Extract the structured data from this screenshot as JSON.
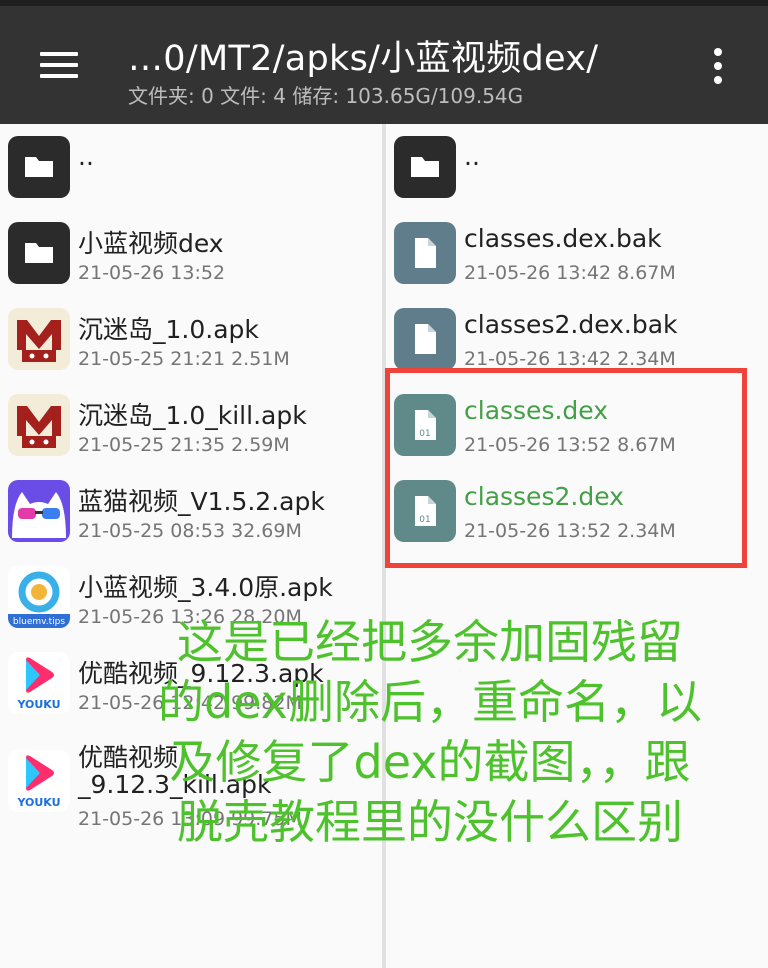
{
  "header": {
    "title": "…0/MT2/apks/小蓝视频dex/",
    "subtitle": "文件夹: 0  文件: 4  储存: 103.65G/109.54G"
  },
  "left_pane": {
    "parent": "..",
    "items": [
      {
        "name": "小蓝视频dex",
        "meta": "21-05-26 13:52",
        "icon": "folder-icon"
      },
      {
        "name": "沉迷岛_1.0.apk",
        "meta": "21-05-25 21:21  2.51M",
        "icon": "m-app-icon"
      },
      {
        "name": "沉迷岛_1.0_kill.apk",
        "meta": "21-05-25 21:35  2.59M",
        "icon": "m-app-icon"
      },
      {
        "name": "蓝猫视频_V1.5.2.apk",
        "meta": "21-05-25 08:53  32.69M",
        "icon": "cat-app-icon"
      },
      {
        "name": "小蓝视频_3.4.0原.apk",
        "meta": "21-05-26 13:26  28.20M",
        "icon": "bluemv-app-icon",
        "icon_text": "bluemv.tips"
      },
      {
        "name": "优酷视频_9.12.3.apk",
        "meta": "21-05-26 12:42  99.82M",
        "icon": "youku-app-icon",
        "icon_text": "YOUKU"
      },
      {
        "name_line1": "优酷视频",
        "name_line2": "_9.12.3_kill.apk",
        "meta": "21-05-26 13:09  99.75M",
        "icon": "youku-app-icon",
        "icon_text": "YOUKU"
      }
    ]
  },
  "right_pane": {
    "parent": "..",
    "items": [
      {
        "name": "classes.dex.bak",
        "meta": "21-05-26 13:42  8.67M",
        "icon": "file-icon"
      },
      {
        "name": "classes2.dex.bak",
        "meta": "21-05-26 13:42  2.34M",
        "icon": "file-icon"
      },
      {
        "name": "classes.dex",
        "meta": "21-05-26 13:52  8.67M",
        "icon": "dex-file-icon",
        "icon_text": "01"
      },
      {
        "name": "classes2.dex",
        "meta": "21-05-26 13:52  2.34M",
        "icon": "dex-file-icon",
        "icon_text": "01"
      }
    ]
  },
  "annotation": {
    "lines": [
      "这是已经把多余加固残留",
      "的dex删除后，重命名，以",
      "及修复了dex的截图，，跟",
      "脱壳教程里的没什么区别"
    ]
  },
  "colors": {
    "topbar": "#333333",
    "highlight_box": "#f0433a",
    "annotation_text": "#4ec22c",
    "dex_name": "#43a047"
  }
}
